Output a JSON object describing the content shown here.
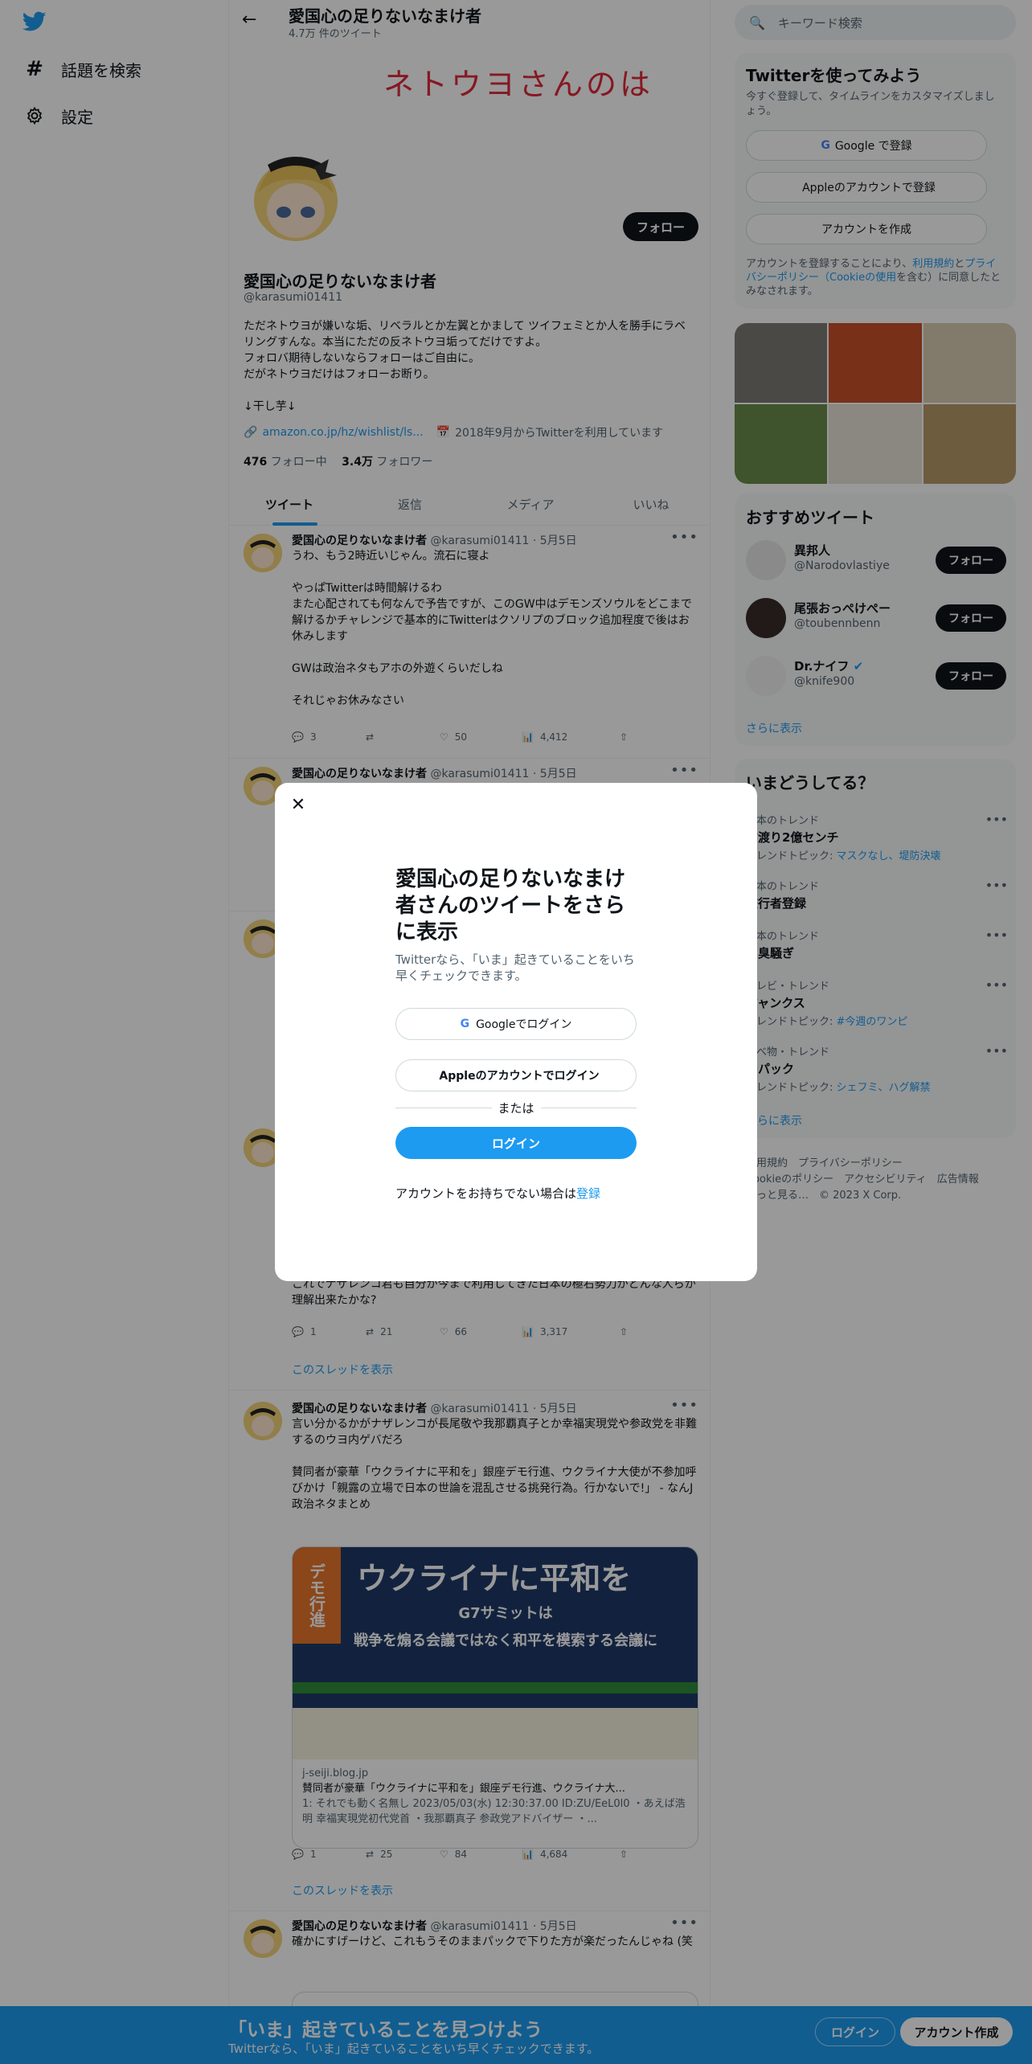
{
  "nav": {
    "logo": "twitter-logo",
    "items": [
      {
        "label": "話題を検索",
        "icon": "hashtag-icon"
      },
      {
        "label": "設定",
        "icon": "gear-icon"
      }
    ]
  },
  "header": {
    "name": "愛国心の足りないなまけ者",
    "tweet_count": "4.7万 件のツイート"
  },
  "banner_text": "ネトウヨさんのは",
  "profile": {
    "name": "愛国心の足りないなまけ者",
    "handle": "@karasumi01411",
    "follow_label": "フォロー",
    "bio": "ただネトウヨが嫌いな垢、リベラルとか左翼とかまして ツイフェミとか人を勝手にラベリングすんな。本当にただの反ネトウヨ垢ってだけですよ。\nフォロバ期待しないならフォローはご自由に。\nだがネトウヨだけはフォローお断り。\n\n↓干し芋↓",
    "link": "amazon.co.jp/hz/wishlist/ls...",
    "joined": "2018年9月からTwitterを利用しています",
    "following_count": "476",
    "following_label": "フォロー中",
    "followers_count": "3.4万",
    "followers_label": "フォロワー"
  },
  "tabs": [
    "ツイート",
    "返信",
    "メディア",
    "いいね"
  ],
  "tweets": [
    {
      "name": "愛国心の足りないなまけ者",
      "meta": "@karasumi01411 · 5月5日",
      "body": "うわ、もう2時近いじゃん。流石に寝よ\n\nやっぱTwitterは時間解けるわ\nまた心配されても何なんで予告ですが、このGW中はデモンズソウルをどこまで解けるかチャレンジで基本的にTwitterはクソリプのブロック追加程度で後はお休みします\n\nGWは政治ネタもアホの外遊くらいだしね\n\nそれじゃお休みなさい",
      "replies": "3",
      "retweets": "",
      "likes": "50",
      "views": "4,412"
    },
    {
      "name": "愛国心の足りないなまけ者",
      "meta": "@karasumi01411 · 5月5日"
    },
    {
      "body": "これでナザレンコ君も自分が今まで利用してきた日本の極右勢力がどんな人らか理解出来たかな?",
      "replies": "1",
      "retweets": "21",
      "likes": "66",
      "views": "3,317",
      "thread": "このスレッドを表示"
    },
    {
      "name": "愛国心の足りないなまけ者",
      "meta": "@karasumi01411 · 5月5日",
      "body": "言い分かるかがナザレンコが長尾敬や我那覇真子とか幸福実現党や参政党を非難するのウヨ内ゲバだろ\n\n賛同者が豪華「ウクライナに平和を」銀座デモ行進、ウクライナ大使が不参加呼びかけ「親露の立場で日本の世論を混乱させる挑発行為。行かないで!」 - なんJ政治ネタまとめ",
      "card": {
        "image_text": "ウクライナに平和を",
        "image_sub": "G7サミットは\n戦争を煽る会議ではなく和平を模索する会議に",
        "domain": "j-seiji.blog.jp",
        "title": "賛同者が豪華「ウクライナに平和を」銀座デモ行進、ウクライナ大...",
        "desc": "1: それでも動く名無し 2023/05/03(水) 12:30:37.00 ID:ZU/EeL0l0 ・あえば浩明 幸福実現党初代党首 ・我那覇真子 参政党アドバイザー ・..."
      },
      "replies": "1",
      "retweets": "25",
      "likes": "84",
      "views": "4,684",
      "thread": "このスレッドを表示"
    },
    {
      "name": "愛国心の足りないなまけ者",
      "meta": "@karasumi01411 · 5月5日",
      "body": "確かにすげーけど、これもうそのままパックで下りた方が楽だったんじゃね (笑"
    }
  ],
  "right": {
    "search_placeholder": "キーワード検索",
    "try": {
      "title": "Twitterを使ってみよう",
      "sub": "今すぐ登録して、タイムラインをカスタマイズしましょう。",
      "google": "Google で登録",
      "apple": "Appleのアカウントで登録",
      "create": "アカウントを作成",
      "legal_pre": "アカウントを登録することにより、",
      "legal_terms": "利用規約",
      "legal_mid": "と",
      "legal_privacy": "プライバシーポリシー",
      "legal_cookie": "（Cookieの使用",
      "legal_post": "を含む）に同意したとみなされます。"
    },
    "recommend": {
      "title": "おすすめツイート",
      "users": [
        {
          "name": "異邦人",
          "handle": "@Narodovlastiye",
          "btn": "フォロー"
        },
        {
          "name": "尾張おっぺけぺー",
          "handle": "@toubennbenn",
          "btn": "フォロー"
        },
        {
          "name": "Dr.ナイフ",
          "handle": "@knife900",
          "btn": "フォロー"
        }
      ],
      "more": "さらに表示"
    },
    "trends": {
      "title": "いまどうしてる？",
      "items": [
        {
          "ctx": "日本のトレンド",
          "title": "前渡り2億センチ",
          "sub_pre": "トレンドトピック: ",
          "sub_link": "マスクなし、堤防決壊"
        },
        {
          "ctx": "日本のトレンド",
          "title": "旅行者登録",
          "sub_pre": "",
          "sub_link": ""
        },
        {
          "ctx": "日本のトレンド",
          "title": "加臭騒ぎ",
          "sub_pre": "",
          "sub_link": ""
        },
        {
          "ctx": "テレビ・トレンド",
          "title": "ジャンクス",
          "sub_pre": "トレンドトピック: ",
          "sub_link": "#今週のワンピ"
        },
        {
          "ctx": "食べ物・トレンド",
          "title": "卵パック",
          "sub_pre": "トレンドトピック: ",
          "sub_link": "シェフミ、ハグ解禁"
        }
      ],
      "more": "さらに表示"
    },
    "footer": "利用規約　プライバシーポリシー\nCookieのポリシー　アクセシビリティ　広告情報\nもっと見る…　© 2023 X Corp."
  },
  "modal": {
    "title": "愛国心の足りないなまけ者さんのツイートをさらに表示",
    "sub": "Twitterなら、「いま」起きていることをいち早くチェックできます。",
    "google": "Googleでログイン",
    "apple": "Appleのアカウントでログイン",
    "or": "または",
    "login": "ログイン",
    "signup_pre": "アカウントをお持ちでない場合は",
    "signup_link": "登録"
  },
  "bottom_bar": {
    "title": "「いま」起きていることを見つけよう",
    "sub": "Twitterなら、「いま」起きていることをいち早くチェックできます。",
    "login": "ログイン",
    "signup": "アカウント作成"
  },
  "colors": {
    "accent": "#1d9bf0",
    "overlay": "rgba(0,0,0,0.4)",
    "banner_text": "#e0283a"
  }
}
